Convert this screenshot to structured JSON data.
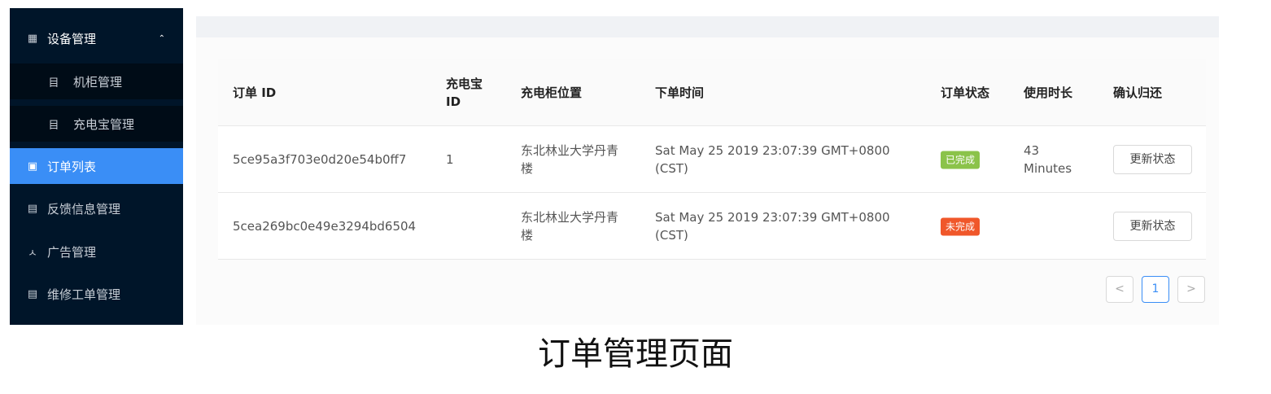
{
  "sidebar": {
    "items": [
      {
        "label": "设备管理",
        "icon": "grid-icon",
        "glyph": "▦",
        "caret": "⌃"
      },
      {
        "label": "机柜管理",
        "icon": "cabinet-icon",
        "glyph": "目"
      },
      {
        "label": "充电宝管理",
        "icon": "powerbank-icon",
        "glyph": "目"
      },
      {
        "label": "订单列表",
        "icon": "order-list-icon",
        "glyph": "▣"
      },
      {
        "label": "反馈信息管理",
        "icon": "feedback-icon",
        "glyph": "▤"
      },
      {
        "label": "广告管理",
        "icon": "ad-icon",
        "glyph": "ㅅ"
      },
      {
        "label": "维修工单管理",
        "icon": "repair-icon",
        "glyph": "▤"
      }
    ],
    "active_index": 3
  },
  "table": {
    "headers": [
      "订单 ID",
      "充电宝 ID",
      "充电柜位置",
      "下单时间",
      "订单状态",
      "使用时长",
      "确认归还"
    ],
    "rows": [
      {
        "order_id": "5ce95a3f703e0d20e54b0ff7",
        "powerbank_id": "1",
        "location": "东北林业大学丹青楼",
        "time": "Sat May 25 2019 23:07:39 GMT+0800 (CST)",
        "status": "已完成",
        "duration": "43 Minutes",
        "action": "更新状态"
      },
      {
        "order_id": "5cea269bc0e49e3294bd6504",
        "powerbank_id": "",
        "location": "东北林业大学丹青楼",
        "time": "Sat May 25 2019 23:07:39 GMT+0800 (CST)",
        "status": "未完成",
        "duration": "",
        "action": "更新状态"
      }
    ]
  },
  "pagination": {
    "prev": "<",
    "current": "1",
    "next": ">"
  },
  "status_colors": {
    "done": "#8bc34a",
    "pending": "#f0572a"
  },
  "caption": "订单管理页面"
}
